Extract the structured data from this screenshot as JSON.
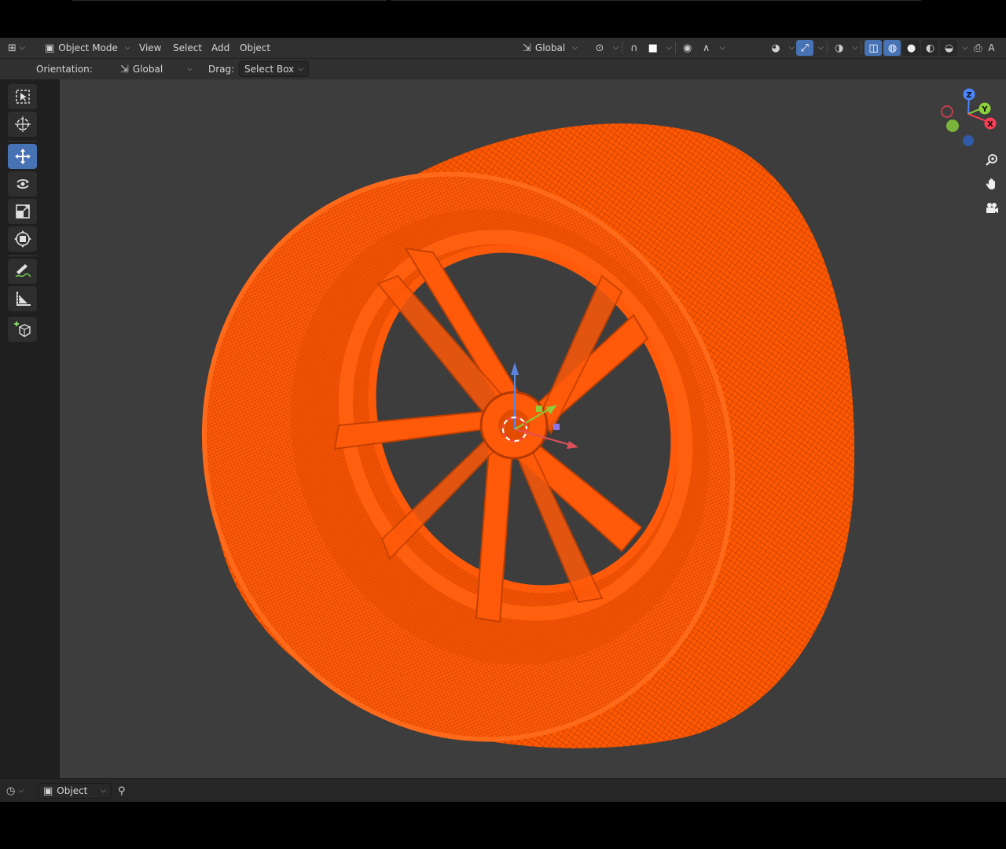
{
  "header": {
    "editor_type_icon": "view3d-icon",
    "mode": {
      "icon": "object-mode-icon",
      "label": "Object Mode"
    },
    "menus": [
      "View",
      "Select",
      "Add",
      "Object"
    ],
    "transform_orientation": {
      "icon": "orientation-global-icon",
      "label": "Global"
    },
    "icons": {
      "pivot": "pivot-point-icon",
      "snap": "snap-magnet-icon",
      "snap_target": "snap-target-icon",
      "proportional": "proportional-edit-icon",
      "falloff": "falloff-curve-icon",
      "visibility": "eye-visibility-icon",
      "gizmos": "gizmo-icon",
      "overlays": "overlay-icon",
      "xray": "xray-icon",
      "shading_wireframe": "wireframe-shading-icon",
      "shading_solid": "solid-shading-icon",
      "shading_material": "material-shading-icon",
      "shading_rendered": "rendered-shading-icon",
      "camera": "camera-icon"
    },
    "truncated_label": "A"
  },
  "tool_settings": {
    "orientation_label": "Orientation:",
    "orientation_value": "Global",
    "drag_label": "Drag:",
    "drag_value": "Select Box"
  },
  "toolbar": {
    "tools": [
      {
        "name": "select-box-tool",
        "icon": "select-box-icon",
        "active": false
      },
      {
        "name": "cursor-tool",
        "icon": "cursor-icon",
        "active": false
      },
      {
        "name": "move-tool",
        "icon": "move-icon",
        "active": true
      },
      {
        "name": "rotate-tool",
        "icon": "rotate-icon",
        "active": false
      },
      {
        "name": "scale-tool",
        "icon": "scale-icon",
        "active": false
      },
      {
        "name": "transform-tool",
        "icon": "transform-icon",
        "active": false
      },
      {
        "name": "annotate-tool",
        "icon": "annotate-icon",
        "active": false
      },
      {
        "name": "measure-tool",
        "icon": "measure-icon",
        "active": false
      },
      {
        "name": "add-cube-tool",
        "icon": "add-cube-icon",
        "active": false
      }
    ]
  },
  "viewport": {
    "object": "wheel-wireframe",
    "selection_color": "#ff5500",
    "background_color": "#3d3d3d",
    "nav_gizmo": {
      "x": "X",
      "y": "Y",
      "z": "Z"
    },
    "nav_icons": [
      "zoom-icon",
      "pan-hand-icon",
      "camera-view-icon"
    ]
  },
  "footer": {
    "editor_icon": "timeline-icon",
    "object_dropdown": {
      "icon": "object-icon",
      "label": "Object"
    },
    "pin_icon": "pin-icon"
  }
}
